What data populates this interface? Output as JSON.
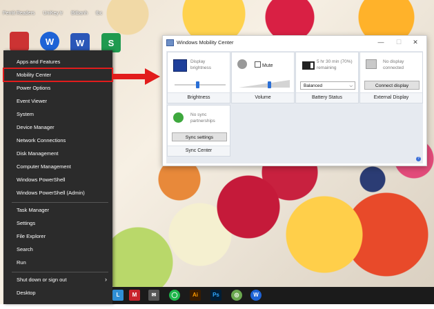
{
  "desktop": {
    "top_labels": [
      "Pentit Readers",
      "UniKey tr",
      "Bitbanh",
      "tbc"
    ],
    "icons": [
      {
        "name": "app-icon",
        "text": ""
      },
      {
        "name": "wps-icon",
        "text": "W"
      },
      {
        "name": "word-icon",
        "text": "W"
      },
      {
        "name": "sheet-icon",
        "text": "S"
      }
    ]
  },
  "winx_menu": {
    "group1": [
      "Apps and Features",
      "Mobility Center",
      "Power Options",
      "Event Viewer",
      "System",
      "Device Manager",
      "Network Connections",
      "Disk Management",
      "Computer Management",
      "Windows PowerShell",
      "Windows PowerShell (Admin)"
    ],
    "group2": [
      "Task Manager",
      "Settings",
      "File Explorer",
      "Search",
      "Run"
    ],
    "group3": [
      "Shut down or sign out",
      "Desktop"
    ],
    "highlighted": "Mobility Center"
  },
  "mobility_center": {
    "title": "Windows Mobility Center",
    "controls": {
      "minimize": "—",
      "maximize": "☐",
      "close": "✕"
    },
    "brightness": {
      "desc": "Display brightness",
      "label": "Brightness",
      "level": 0.45
    },
    "volume": {
      "mute_label": "Mute",
      "muted": false,
      "label": "Volume",
      "level": 0.6
    },
    "battery": {
      "desc_line1": "5 hr 30 min (70%)",
      "desc_line2": "remaining",
      "plan": "Balanced",
      "label": "Battery Status"
    },
    "external_display": {
      "desc_line1": "No display",
      "desc_line2": "connected",
      "button": "Connect display",
      "label": "External Display"
    },
    "sync": {
      "desc_line1": "No sync",
      "desc_line2": "partnerships",
      "button": "Sync settings",
      "label": "Sync Center"
    }
  },
  "taskbar": {
    "icons": [
      "L",
      "M",
      "✉",
      "◯",
      "Ai",
      "Ps",
      "◎",
      "W"
    ]
  },
  "colors": {
    "highlight": "#e21c1c",
    "accent": "#2a6fd6",
    "menu_bg": "#2b2b2b"
  }
}
